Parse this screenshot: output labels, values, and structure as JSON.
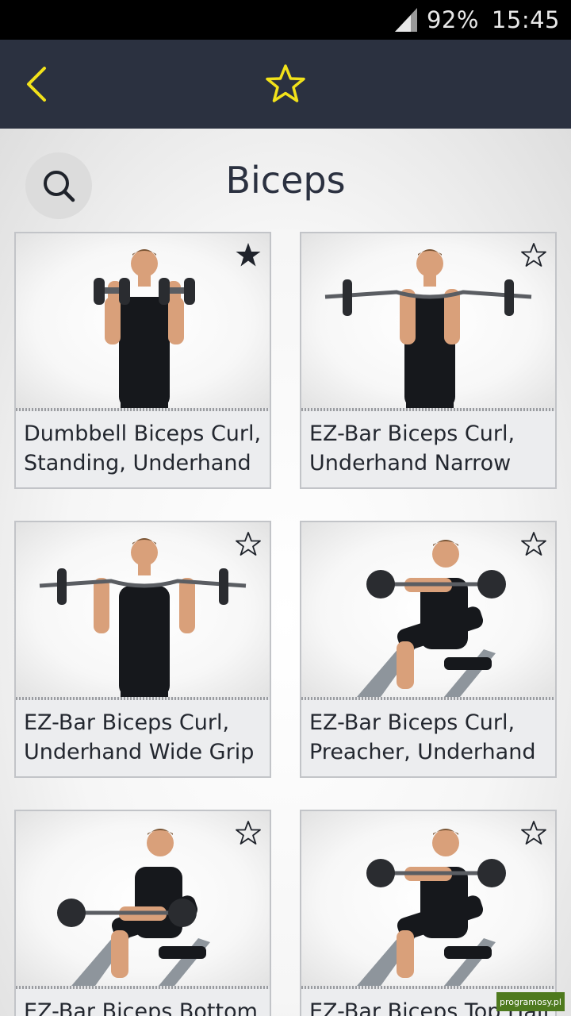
{
  "status_bar": {
    "battery": "92%",
    "time": "15:45",
    "icons": [
      "signal-icon"
    ]
  },
  "app_bar": {
    "icons": [
      "back-chevron-icon",
      "star-outline-icon"
    ],
    "accent_color": "#f2e21a",
    "background_color": "#2b3140"
  },
  "page": {
    "title": "Biceps",
    "search_icon": "search-icon"
  },
  "exercises": [
    {
      "label": "Dumbbell Biceps Curl, Standing, Underhand",
      "favorite": true,
      "pose": "standing-dumbbell"
    },
    {
      "label": "EZ-Bar Biceps Curl, Underhand Narrow",
      "favorite": false,
      "pose": "standing-ezbar-narrow"
    },
    {
      "label": "EZ-Bar Biceps Curl, Underhand Wide Grip",
      "favorite": false,
      "pose": "standing-ezbar-wide"
    },
    {
      "label": "EZ-Bar Biceps Curl, Preacher, Underhand",
      "favorite": false,
      "pose": "preacher"
    },
    {
      "label": "EZ-Bar Biceps Bottom",
      "favorite": false,
      "pose": "preacher-bottom"
    },
    {
      "label": "EZ-Bar Biceps Top Half",
      "favorite": false,
      "pose": "preacher-top"
    }
  ],
  "watermark": "programosy.pl"
}
